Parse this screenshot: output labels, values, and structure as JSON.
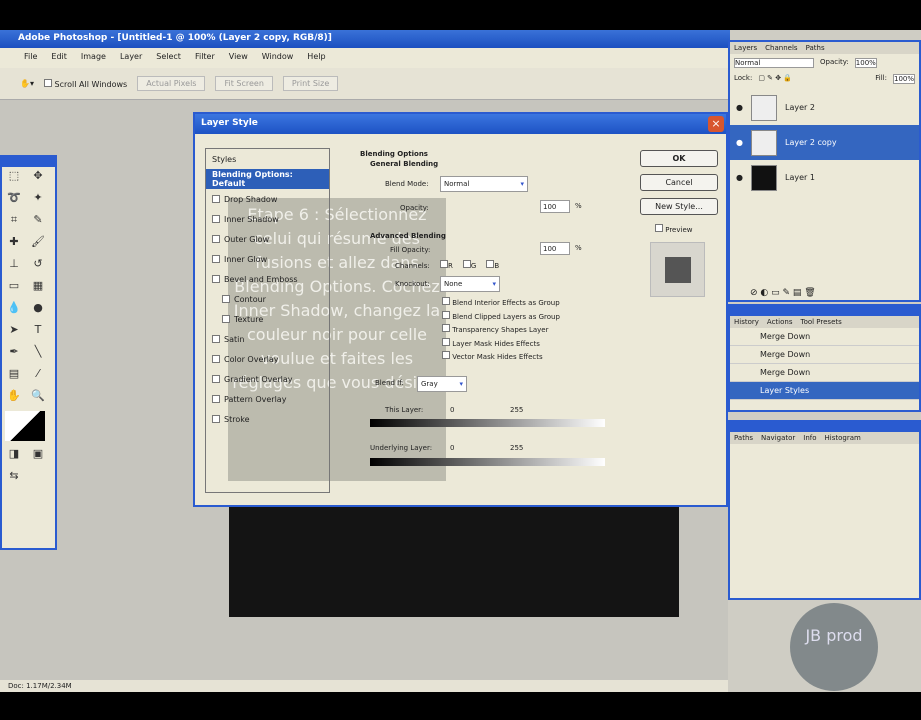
{
  "app": {
    "title": "Adobe Photoshop - [Untitled-1 @ 100% (Layer 2 copy, RGB/8)]"
  },
  "menu": [
    "File",
    "Edit",
    "Image",
    "Layer",
    "Select",
    "Filter",
    "View",
    "Window",
    "Help"
  ],
  "options": {
    "auto_select": "Scroll All Windows",
    "buttons": [
      "Actual Pixels",
      "Fit Screen",
      "Print Size"
    ]
  },
  "dialog": {
    "title": "Layer Style",
    "styles": [
      "Styles",
      "Blending Options: Default",
      "Drop Shadow",
      "Inner Shadow",
      "Outer Glow",
      "Inner Glow",
      "Bevel and Emboss",
      "Contour",
      "Texture",
      "Satin",
      "Color Overlay",
      "Gradient Overlay",
      "Pattern Overlay",
      "Stroke"
    ],
    "section": "Blending Options",
    "subsection": "General Blending",
    "blend_mode_label": "Blend Mode:",
    "blend_mode": "Normal",
    "opacity_label": "Opacity:",
    "opacity": "100",
    "pct": "%",
    "advanced": "Advanced Blending",
    "fill_label": "Fill Opacity:",
    "fill": "100",
    "channels_label": "Channels:",
    "channels": [
      "R",
      "G",
      "B"
    ],
    "knockout_label": "Knockout:",
    "knockout": "None",
    "checks": [
      "Blend Interior Effects as Group",
      "Blend Clipped Layers as Group",
      "Transparency Shapes Layer",
      "Layer Mask Hides Effects",
      "Vector Mask Hides Effects"
    ],
    "blend_if_label": "Blend If:",
    "blend_if": "Gray",
    "this_layer": "This Layer:",
    "underlying": "Underlying Layer:",
    "v0": "0",
    "v255": "255",
    "buttons": {
      "ok": "OK",
      "cancel": "Cancel",
      "new_style": "New Style...",
      "preview": "Preview"
    }
  },
  "overlay_text": "Etape 6 : Sélectionnez celui qui résume des fusions et allez dans Blending Options. Cochez Inner Shadow, changez la couleur noir pour celle voulue et faites les réglages que vous désirez",
  "layers": {
    "tabs": [
      "Layers",
      "Channels",
      "Paths"
    ],
    "mode": "Normal",
    "opacity_label": "Opacity:",
    "opacity": "100%",
    "lock": "Lock:",
    "fill_label": "Fill:",
    "fill": "100%",
    "items": [
      "Layer 2",
      "Layer 2 copy",
      "Layer 1"
    ]
  },
  "history": {
    "tabs": [
      "History",
      "Actions",
      "Tool Presets"
    ],
    "items": [
      "Merge Down",
      "Merge Down",
      "Merge Down",
      "Layer Styles"
    ]
  },
  "paths": {
    "tabs": [
      "Paths",
      "Navigator",
      "Info",
      "Histogram"
    ]
  },
  "status": "Doc: 1.17M/2.34M",
  "watermark": "JB prod"
}
